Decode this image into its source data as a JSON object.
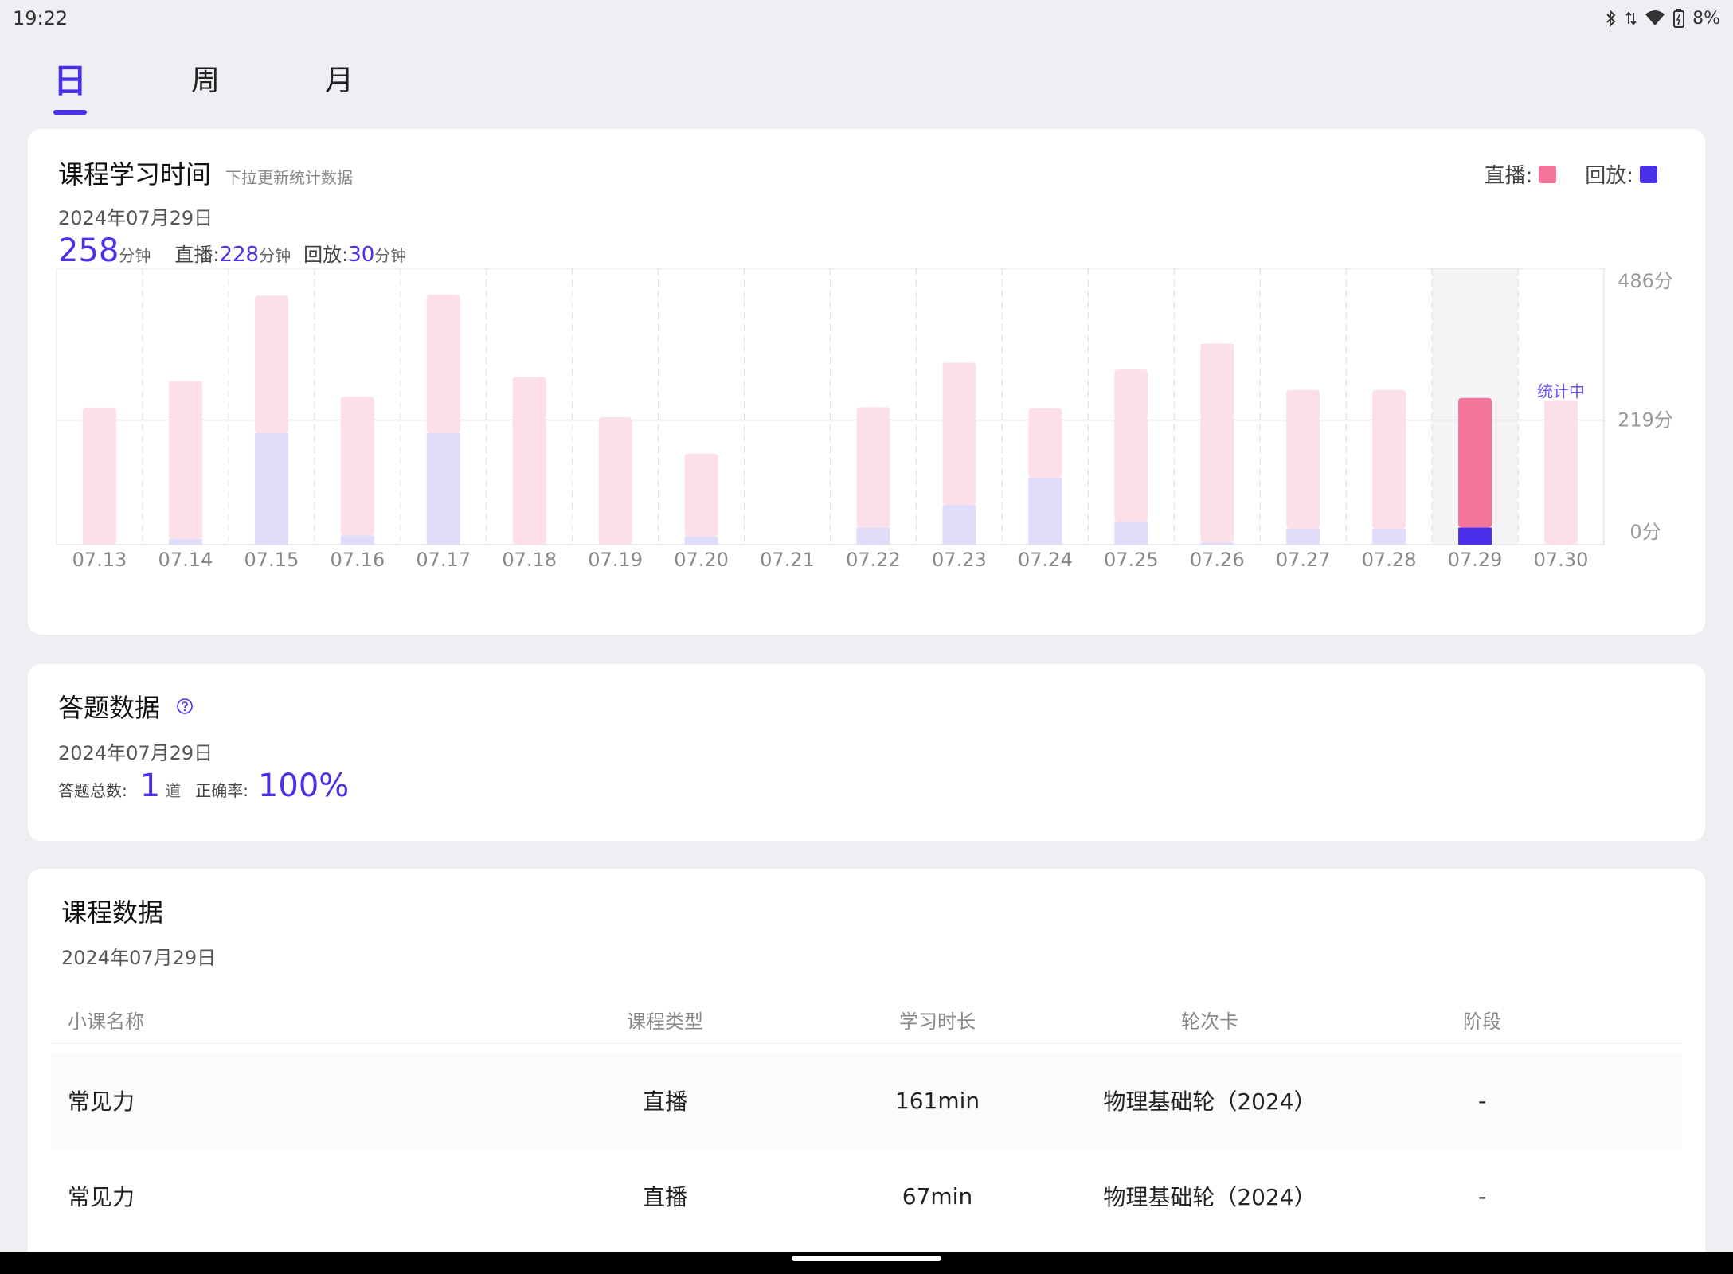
{
  "status_bar": {
    "time": "19:22",
    "battery": "8%",
    "icons": [
      "bluetooth-icon",
      "signal-icon",
      "wifi-icon",
      "battery-icon"
    ]
  },
  "tabs": [
    {
      "label": "日",
      "active": true
    },
    {
      "label": "周",
      "active": false
    },
    {
      "label": "月",
      "active": false
    }
  ],
  "study_card": {
    "title": "课程学习时间",
    "subtitle": "下拉更新统计数据",
    "date": "2024年07月29日",
    "total": "258",
    "total_unit": "分钟",
    "live_label": "直播:",
    "live_value": "228",
    "live_unit": "分钟",
    "replay_label": "回放:",
    "replay_value": "30",
    "replay_unit": "分钟",
    "legend": [
      {
        "label": "直播:",
        "color": "#f27499"
      },
      {
        "label": "回放:",
        "color": "#4a30e8"
      }
    ]
  },
  "chart_data": {
    "type": "bar",
    "stacked": true,
    "categories": [
      "07.13",
      "07.14",
      "07.15",
      "07.16",
      "07.17",
      "07.18",
      "07.19",
      "07.20",
      "07.21",
      "07.22",
      "07.23",
      "07.24",
      "07.25",
      "07.26",
      "07.27",
      "07.28",
      "07.29",
      "07.30"
    ],
    "series": [
      {
        "name": "回放",
        "color": "#4a30e8",
        "values": [
          0,
          10,
          196,
          16,
          196,
          0,
          0,
          14,
          0,
          30,
          70,
          118,
          40,
          4,
          28,
          28,
          30,
          0
        ]
      },
      {
        "name": "直播",
        "color": "#f27499",
        "values": [
          241,
          278,
          242,
          244,
          244,
          295,
          224,
          146,
          0,
          212,
          250,
          122,
          268,
          350,
          244,
          244,
          228,
          254
        ]
      }
    ],
    "y_ticks": [
      "486分",
      "219分",
      "0分"
    ],
    "ylim": [
      0,
      486
    ],
    "highlight_index": 16,
    "highlight_label": "统计中",
    "faded_colors": {
      "直播": "#fddfe8",
      "回放": "#e0dcfa"
    }
  },
  "quiz_card": {
    "title": "答题数据",
    "help_icon": "question-circle-icon",
    "date": "2024年07月29日",
    "total_label": "答题总数:",
    "total_value": "1",
    "total_unit": "道",
    "accuracy_label": "正确率:",
    "accuracy_value": "100%"
  },
  "course_card": {
    "title": "课程数据",
    "date": "2024年07月29日",
    "columns": [
      "小课名称",
      "课程类型",
      "学习时长",
      "轮次卡",
      "阶段"
    ],
    "rows": [
      [
        "常见力",
        "直播",
        "161min",
        "物理基础轮（2024）",
        "-"
      ],
      [
        "常见力",
        "直播",
        "67min",
        "物理基础轮（2024）",
        "-"
      ]
    ]
  }
}
